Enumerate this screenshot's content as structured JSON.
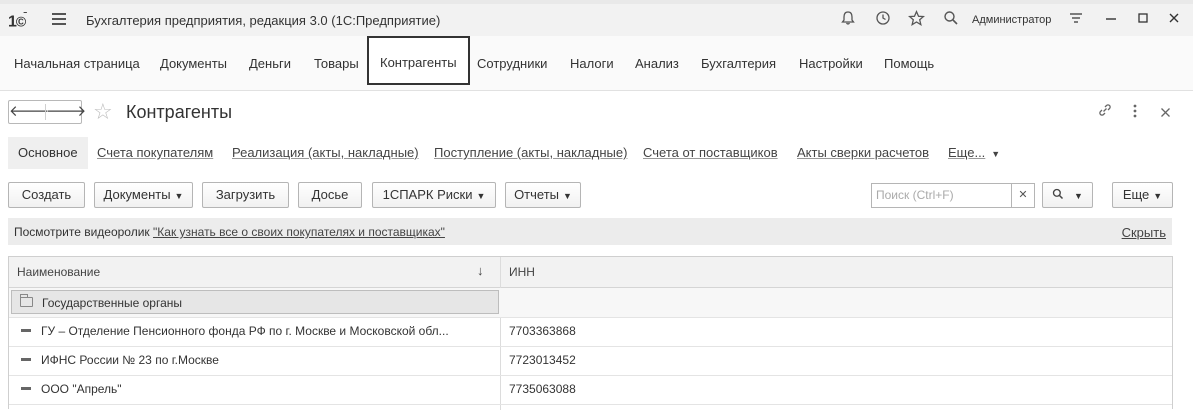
{
  "titlebar": {
    "app_title": "Бухгалтерия предприятия, редакция 3.0  (1С:Предприятие)",
    "user": "Администратор"
  },
  "sections": [
    {
      "label": "Начальная страница"
    },
    {
      "label": "Документы"
    },
    {
      "label": "Деньги"
    },
    {
      "label": "Товары"
    },
    {
      "label": "Контрагенты",
      "active": true
    },
    {
      "label": "Сотрудники"
    },
    {
      "label": "Налоги"
    },
    {
      "label": "Анализ"
    },
    {
      "label": "Бухгалтерия"
    },
    {
      "label": "Настройки"
    },
    {
      "label": "Помощь"
    }
  ],
  "form": {
    "title": "Контрагенты"
  },
  "tabs": [
    {
      "label": "Основное"
    },
    {
      "label": "Счета покупателям"
    },
    {
      "label": "Реализация (акты, накладные)"
    },
    {
      "label": "Поступление (акты, накладные)"
    },
    {
      "label": "Счета от поставщиков"
    },
    {
      "label": "Акты сверки расчетов"
    },
    {
      "label": "Еще..."
    }
  ],
  "toolbar": {
    "create": "Создать",
    "documents": "Документы",
    "load": "Загрузить",
    "dossier": "Досье",
    "spark": "1СПАРК Риски",
    "reports": "Отчеты",
    "search_placeholder": "Поиск (Ctrl+F)",
    "more": "Еще"
  },
  "info": {
    "prefix": "Посмотрите видеоролик ",
    "link": "\"Как узнать все о своих покупателях и поставщиках\"",
    "hide": "Скрыть"
  },
  "table": {
    "columns": [
      "Наименование",
      "ИНН"
    ],
    "group": "Государственные органы",
    "rows": [
      {
        "name": "ГУ – Отделение Пенсионного фонда РФ по г. Москве и Московской обл...",
        "inn": "7703363868"
      },
      {
        "name": "ИФНС России № 23 по г.Москве",
        "inn": "7723013452"
      },
      {
        "name": "ООО \"Апрель\"",
        "inn": "7735063088"
      }
    ]
  }
}
